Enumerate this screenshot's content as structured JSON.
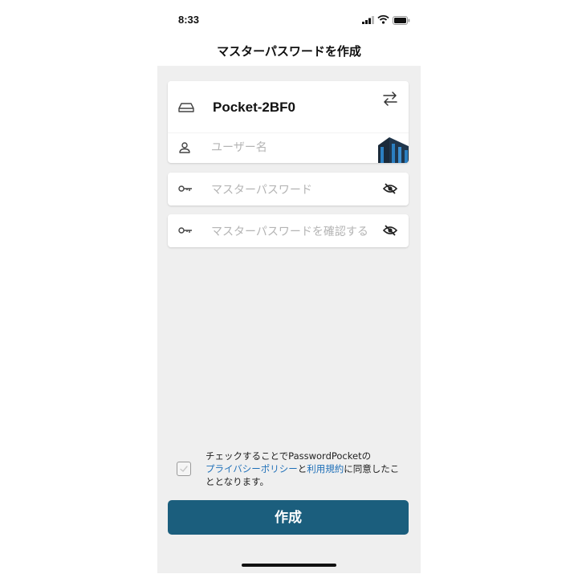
{
  "status": {
    "time": "8:33"
  },
  "nav": {
    "title": "マスターパスワードを作成"
  },
  "device": {
    "name": "Pocket-2BF0",
    "username_placeholder": "ユーザー名"
  },
  "password": {
    "placeholder": "マスターパスワード"
  },
  "confirm": {
    "placeholder": "マスターパスワードを確認する"
  },
  "agreement": {
    "text_pre": "チェックすることでPasswordPocketの",
    "privacy_link": "プライバシーポリシー",
    "conj": "と",
    "terms_link": "利用規約",
    "text_post": "に同意したこととなります。",
    "checked": false
  },
  "actions": {
    "create_label": "作成"
  },
  "colors": {
    "primary": "#1b5e7d",
    "link": "#1e6fb8",
    "background": "#efefef",
    "card": "#ffffff"
  },
  "icons": {
    "device": "drive-icon",
    "user": "user-icon",
    "swap": "swap-arrows-icon",
    "key": "key-icon",
    "visibility": "eye-slash-icon"
  }
}
